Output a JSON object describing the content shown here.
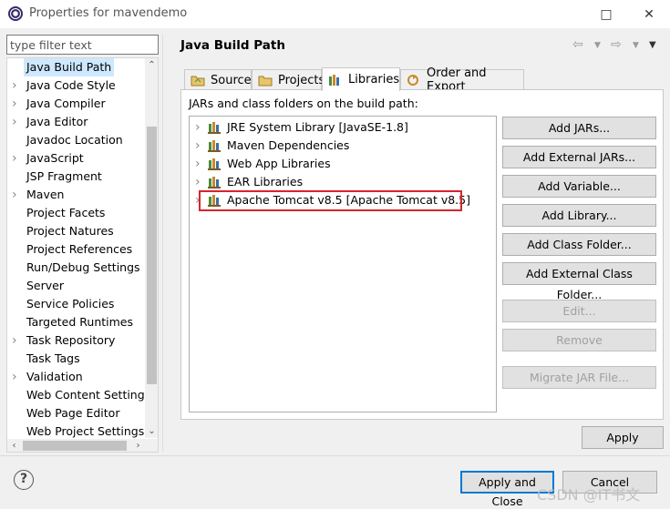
{
  "window": {
    "title": "Properties for mavendemo",
    "minimize_glyph": "□",
    "close_glyph": "✕"
  },
  "sidebar": {
    "filter_placeholder": "type filter text",
    "items": [
      {
        "label": "Java Build Path",
        "expandable": false,
        "selected": true
      },
      {
        "label": "Java Code Style",
        "expandable": true
      },
      {
        "label": "Java Compiler",
        "expandable": true
      },
      {
        "label": "Java Editor",
        "expandable": true
      },
      {
        "label": "Javadoc Location",
        "expandable": false
      },
      {
        "label": "JavaScript",
        "expandable": true
      },
      {
        "label": "JSP Fragment",
        "expandable": false
      },
      {
        "label": "Maven",
        "expandable": true
      },
      {
        "label": "Project Facets",
        "expandable": false
      },
      {
        "label": "Project Natures",
        "expandable": false
      },
      {
        "label": "Project References",
        "expandable": false
      },
      {
        "label": "Run/Debug Settings",
        "expandable": false
      },
      {
        "label": "Server",
        "expandable": false
      },
      {
        "label": "Service Policies",
        "expandable": false
      },
      {
        "label": "Targeted Runtimes",
        "expandable": false
      },
      {
        "label": "Task Repository",
        "expandable": true
      },
      {
        "label": "Task Tags",
        "expandable": false
      },
      {
        "label": "Validation",
        "expandable": true
      },
      {
        "label": "Web Content Settings",
        "expandable": false
      },
      {
        "label": "Web Page Editor",
        "expandable": false
      },
      {
        "label": "Web Project Settings",
        "expandable": false
      }
    ]
  },
  "main": {
    "title": "Java Build Path",
    "tabs": [
      {
        "label": "Source",
        "icon": "source-folder-icon"
      },
      {
        "label": "Projects",
        "icon": "projects-folder-icon"
      },
      {
        "label": "Libraries",
        "icon": "libraries-icon",
        "active": true
      },
      {
        "label": "Order and Export",
        "icon": "order-export-icon"
      }
    ],
    "panel_label": "JARs and class folders on the build path:",
    "libraries": [
      {
        "label": "JRE System Library [JavaSE-1.8]"
      },
      {
        "label": "Maven Dependencies"
      },
      {
        "label": "Web App Libraries"
      },
      {
        "label": "EAR Libraries"
      },
      {
        "label": "Apache Tomcat v8.5 [Apache Tomcat v8.5]",
        "highlighted": true
      }
    ],
    "buttons": [
      {
        "label": "Add JARs...",
        "enabled": true
      },
      {
        "label": "Add External JARs...",
        "enabled": true
      },
      {
        "label": "Add Variable...",
        "enabled": true
      },
      {
        "label": "Add Library...",
        "enabled": true
      },
      {
        "label": "Add Class Folder...",
        "enabled": true
      },
      {
        "label": "Add External Class Folder...",
        "enabled": true
      },
      {
        "label": "Edit...",
        "enabled": false
      },
      {
        "label": "Remove",
        "enabled": false
      },
      {
        "label": "Migrate JAR File...",
        "enabled": false
      }
    ],
    "apply_label": "Apply"
  },
  "footer": {
    "help_glyph": "?",
    "apply_close_label": "Apply and Close",
    "cancel_label": "Cancel"
  },
  "watermark": "CSDN @IT书文",
  "colors": {
    "highlight_border": "#d9232d",
    "selection_bg": "#cde8ff",
    "default_button_border": "#0078d7"
  }
}
